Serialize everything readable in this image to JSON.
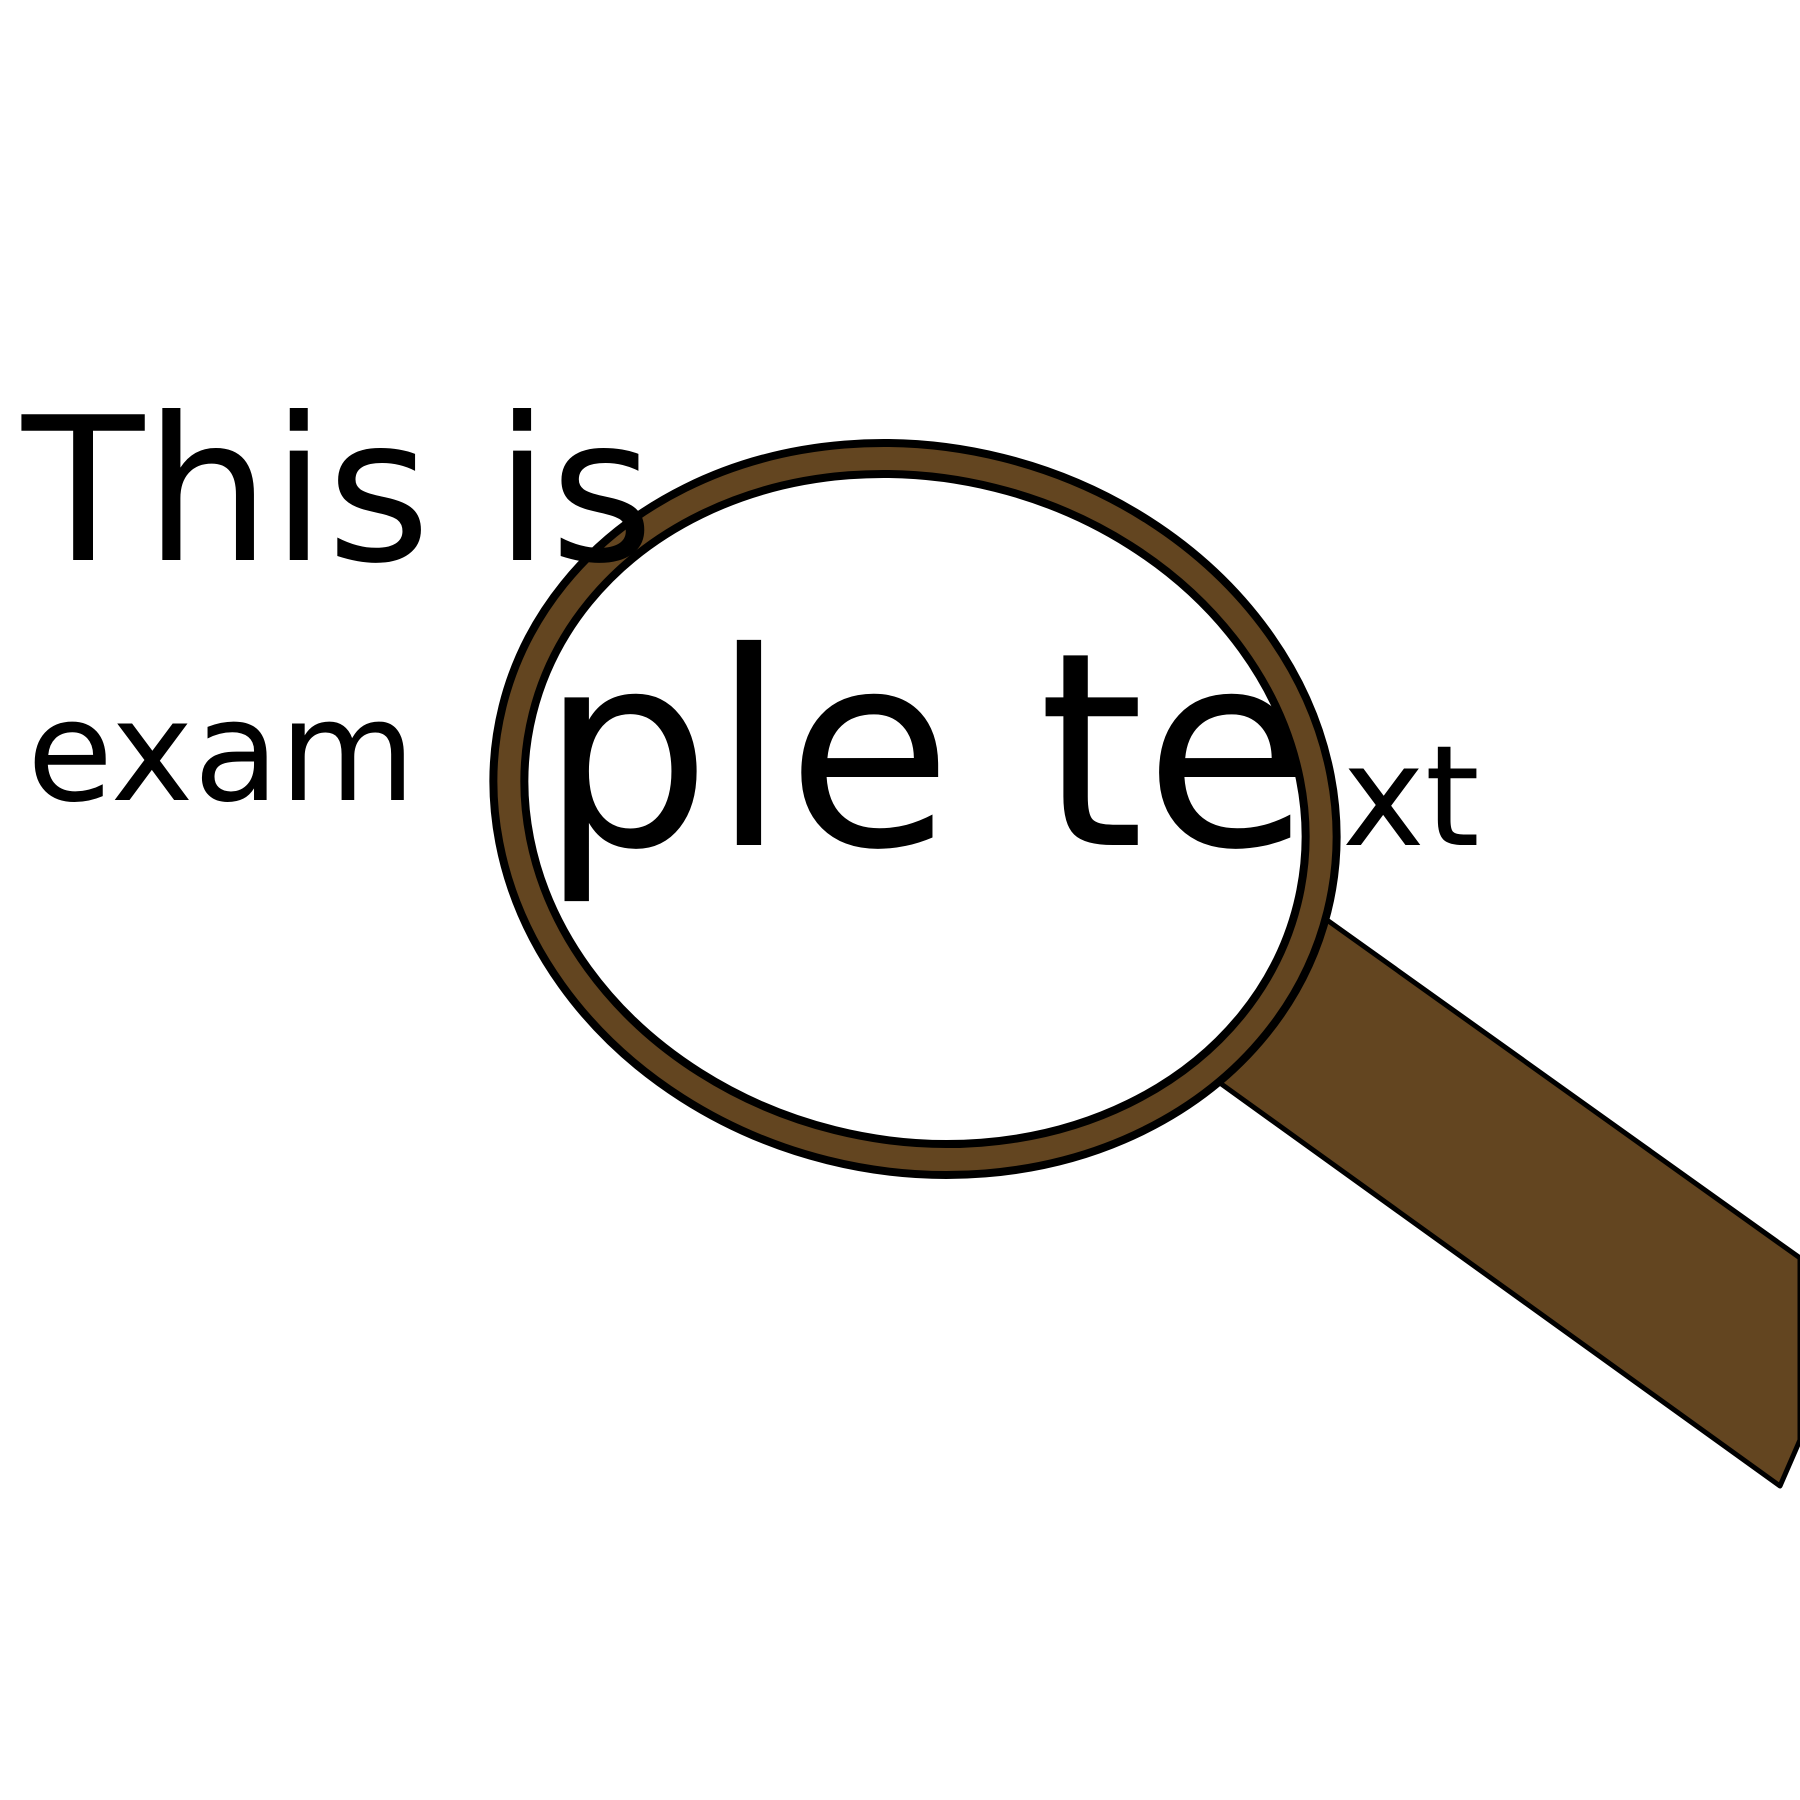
{
  "illustration": {
    "line1": "This is",
    "line2_left": "exam",
    "line2_magnified": "ple te",
    "line2_right": "xt",
    "text_color": "#000000",
    "handle_color": "#634520",
    "rim_color": "#634520",
    "outline_color": "#000000",
    "background_color": "#ffffff"
  }
}
